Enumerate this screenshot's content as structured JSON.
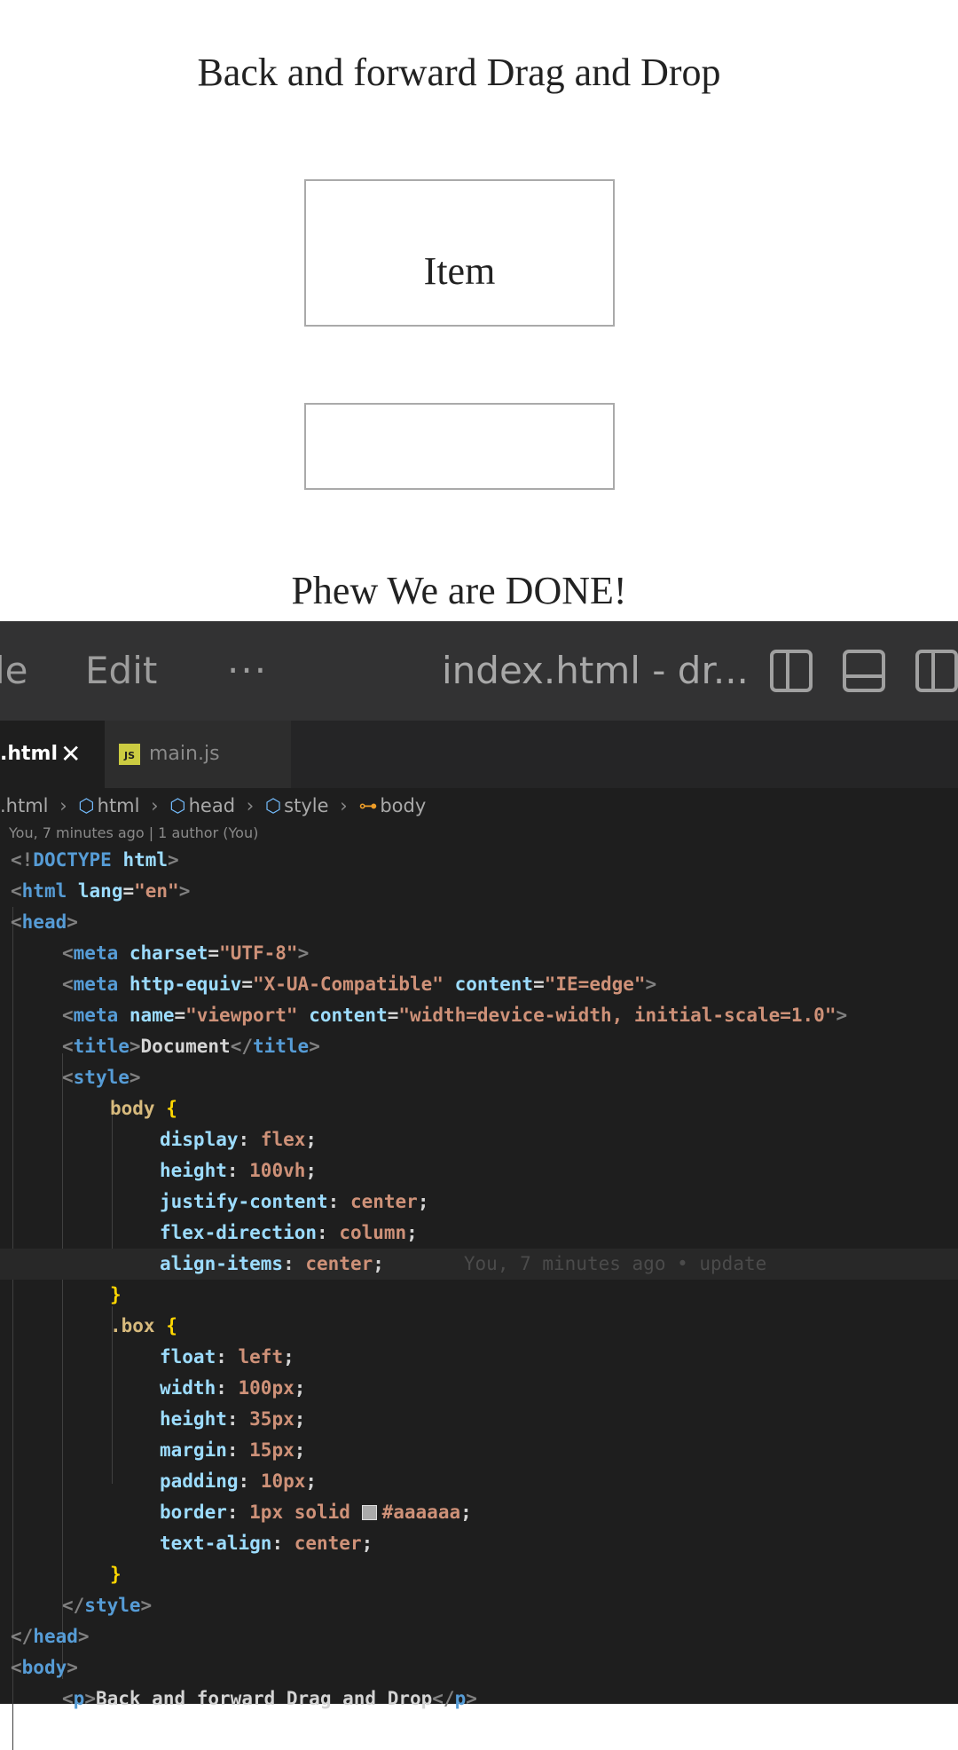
{
  "preview": {
    "heading": "Back and forward Drag and Drop",
    "item_label": "Item",
    "footer": "Phew We are DONE!"
  },
  "editor": {
    "menu": {
      "file": "le",
      "edit": "Edit",
      "more": "···"
    },
    "window_title": "index.html - dr...",
    "tabs": [
      {
        "label": ".html",
        "close": "✕"
      },
      {
        "label": "main.js",
        "icon": "JS"
      }
    ],
    "breadcrumb": [
      {
        "label": ".html"
      },
      {
        "icon": "html-element-icon",
        "label": "html"
      },
      {
        "icon": "html-element-icon",
        "label": "head"
      },
      {
        "icon": "html-element-icon",
        "label": "style"
      },
      {
        "icon": "css-selector-icon",
        "label": "body"
      }
    ],
    "blame": "You, 7 minutes ago | 1 author (You)",
    "inline_blame": "You, 7 minutes ago • update",
    "code": {
      "l1_open": "<!",
      "l1_kw": "DOCTYPE",
      "l1_sp": " ",
      "l1_attr": "html",
      "l1_close": ">",
      "l2_open": "<",
      "l2_tag": "html",
      "l2_attr": "lang",
      "l2_eq": "=",
      "l2_val": "\"en\"",
      "l2_close": ">",
      "l3_open": "<",
      "l3_tag": "head",
      "l3_close": ">",
      "l4_tag": "meta",
      "l4_attr": "charset",
      "l4_val": "\"UTF-8\"",
      "l5_tag": "meta",
      "l5_attr1": "http-equiv",
      "l5_val1": "\"X-UA-Compatible\"",
      "l5_attr2": "content",
      "l5_val2": "\"IE=edge\"",
      "l6_tag": "meta",
      "l6_attr1": "name",
      "l6_val1": "\"viewport\"",
      "l6_attr2": "content",
      "l6_val2": "\"width=device-width, initial-scale=1.0\"",
      "l7_tag": "title",
      "l7_text": "Document",
      "l7_close_tag": "title",
      "l8_tag": "style",
      "l9_sel": "body",
      "l9_brace": "{",
      "l10_prop": "display",
      "l10_val": "flex",
      "l11_prop": "height",
      "l11_val": "100vh",
      "l12_prop": "justify-content",
      "l12_val": "center",
      "l13_prop": "flex-direction",
      "l13_val": "column",
      "l14_prop": "align-items",
      "l14_val": "center",
      "l15_brace": "}",
      "l16_sel": ".box",
      "l16_brace": "{",
      "l17_prop": "float",
      "l17_val": "left",
      "l18_prop": "width",
      "l18_val": "100px",
      "l19_prop": "height",
      "l19_val": "35px",
      "l20_prop": "margin",
      "l20_val": "15px",
      "l21_prop": "padding",
      "l21_val": "10px",
      "l22_prop": "border",
      "l22_val": "1px solid",
      "l22_color": "#aaaaaa",
      "l23_prop": "text-align",
      "l23_val": "center",
      "l24_brace": "}",
      "l25_tag": "style",
      "l26_tag": "head",
      "l27_tag": "body",
      "l28_tag": "p",
      "l28_text": "Back and forward Drag and Drop"
    }
  }
}
